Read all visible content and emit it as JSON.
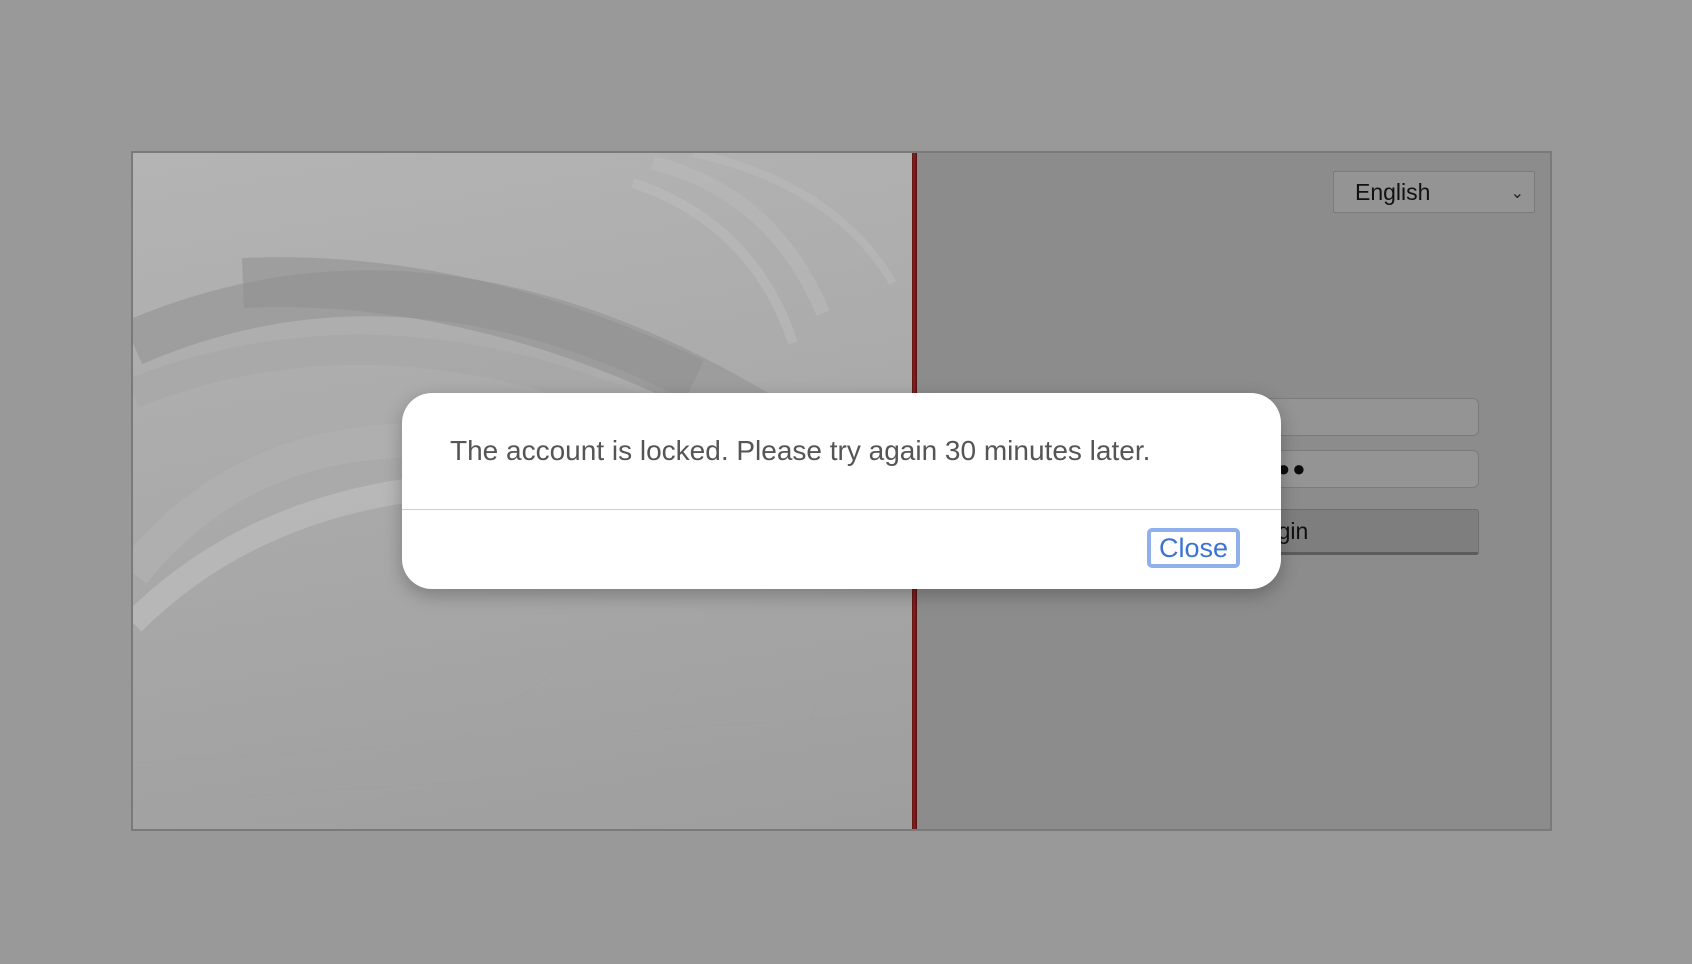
{
  "language_select": {
    "selected": "English",
    "chevron_icon": "chevron-down-icon"
  },
  "login_form": {
    "username_value": "",
    "password_mask": "●●●●●●●●●",
    "login_label": "Login"
  },
  "dialog": {
    "message": "The account is locked. Please try again 30 minutes later.",
    "close_label": "Close"
  },
  "colors": {
    "overlay": "#999999",
    "divider_red": "#8a1f1f",
    "close_text": "#3b73d4",
    "close_focus_ring": "#8fb0ec"
  }
}
